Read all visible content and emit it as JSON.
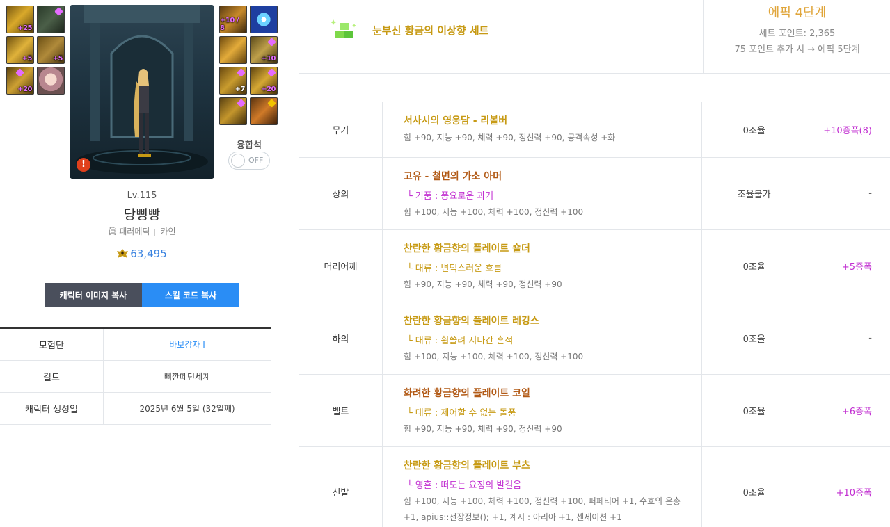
{
  "slots": {
    "left": [
      {
        "name": "helmet-slot",
        "text": "+25"
      },
      {
        "name": "cape-slot",
        "text": ""
      },
      {
        "name": "shoulder-slot",
        "text": "+5"
      },
      {
        "name": "top-slot",
        "text": "+5"
      },
      {
        "name": "bottom-slot",
        "text": "+20"
      },
      {
        "name": "pet-slot",
        "text": ""
      }
    ],
    "right": [
      {
        "name": "weapon-slot",
        "text": "+10 / 8"
      },
      {
        "name": "title-slot",
        "text": ""
      },
      {
        "name": "bracelet-slot",
        "text": ""
      },
      {
        "name": "necklace-slot",
        "text": "+10"
      },
      {
        "name": "ring-slot",
        "text": "+7"
      },
      {
        "name": "earring-slot",
        "text": "+20"
      },
      {
        "name": "stone-slot",
        "text": ""
      },
      {
        "name": "sub-slot",
        "text": ""
      }
    ]
  },
  "fusion": {
    "label": "융합석",
    "toggle": "OFF"
  },
  "character": {
    "level": "Lv.115",
    "name": "당삥빵",
    "job": "眞 패러메딕",
    "server": "카인",
    "power": "63,495"
  },
  "buttons": {
    "copy_image": "캐릭터 이미지 복사",
    "copy_skill": "스킬 코드 복사"
  },
  "info": [
    {
      "key": "모험단",
      "value": "바보감자 I"
    },
    {
      "key": "길드",
      "value": "삐깐떼던세계"
    },
    {
      "key": "캐릭터 생성일",
      "value": "2025년 6월 5일 (32일째)"
    }
  ],
  "set": {
    "name": "눈부신 황금의 이상향 세트",
    "grade": "에픽 4단계",
    "points": "세트 포인트: 2,365",
    "next": "75 포인트 추가 시 → 에픽 5단계"
  },
  "equipment": [
    {
      "slot": "무기",
      "name": "서사시의 영웅담 - 리볼버",
      "sub": "",
      "stats": "힘 +90, 지능 +90, 체력 +90, 정신력 +90, 공격속성 +화",
      "tune": "0조율",
      "amp": "+10증폭(8)"
    },
    {
      "slot": "상의",
      "name": "고유 - 철면의 가소 아머",
      "sub": "└ 기품 : 풍요로운 과거",
      "stats": "힘 +100, 지능 +100, 체력 +100, 정신력 +100",
      "tune": "조율불가",
      "amp": "-"
    },
    {
      "slot": "머리어깨",
      "name": "찬란한 황금향의 플레이트 숄더",
      "sub": "└ 대류 : 변덕스러운 흐름",
      "stats": "힘 +90, 지능 +90, 체력 +90, 정신력 +90",
      "tune": "0조율",
      "amp": "+5증폭"
    },
    {
      "slot": "하의",
      "name": "찬란한 황금향의 플레이트 레깅스",
      "sub": "└ 대류 : 휩쓸려 지나간 흔적",
      "stats": "힘 +100, 지능 +100, 체력 +100, 정신력 +100",
      "tune": "0조율",
      "amp": "-"
    },
    {
      "slot": "벨트",
      "name": "화려한 황금향의 플레이트 코일",
      "sub": "└ 대류 : 제어할 수 없는 돌풍",
      "stats": "힘 +90, 지능 +90, 체력 +90, 정신력 +90",
      "tune": "0조율",
      "amp": "+6증폭"
    },
    {
      "slot": "신발",
      "name": "찬란한 황금향의 플레이트 부츠",
      "sub": "└ 영혼 : 떠도는 요정의 발걸음",
      "stats": "힘 +100, 지능 +100, 체력 +100, 정신력 +100, 퍼페티어 +1, 수호의 은총 +1, apius::전장정보(); +1, 계시 : 아리아 +1, 센세이션 +1",
      "tune": "0조율",
      "amp": "+10증폭"
    }
  ],
  "colors": {
    "gold": "#c79a14",
    "brown": "#b25a16",
    "purple": "#c22fd1",
    "blue": "#2a8df5",
    "grade": "#e0a53a"
  }
}
